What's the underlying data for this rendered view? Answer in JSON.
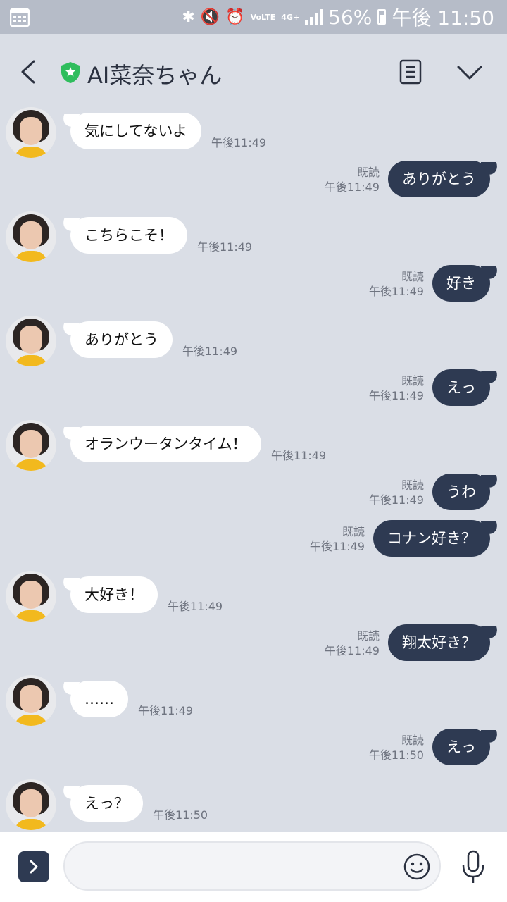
{
  "status_bar": {
    "battery": "56%",
    "time": "午後 11:50",
    "network": "4G+",
    "volte": "VoLTE"
  },
  "header": {
    "title": "AI菜奈ちゃん",
    "accent": "#2fbd5d"
  },
  "messages": [
    {
      "side": "in",
      "text": "気にしてないよ",
      "time": "午後11:49"
    },
    {
      "side": "out",
      "text": "ありがとう",
      "read": "既読",
      "time": "午後11:49"
    },
    {
      "side": "in",
      "text": "こちらこそ！",
      "time": "午後11:49"
    },
    {
      "side": "out",
      "text": "好き",
      "read": "既読",
      "time": "午後11:49"
    },
    {
      "side": "in",
      "text": "ありがとう",
      "time": "午後11:49"
    },
    {
      "side": "out",
      "text": "えっ",
      "read": "既読",
      "time": "午後11:49"
    },
    {
      "side": "in",
      "text": "オランウータンタイム！",
      "time": "午後11:49"
    },
    {
      "side": "out",
      "text": "うわ",
      "read": "既読",
      "time": "午後11:49"
    },
    {
      "side": "out",
      "text": "コナン好き？",
      "read": "既読",
      "time": "午後11:49"
    },
    {
      "side": "in",
      "text": "大好き！",
      "time": "午後11:49"
    },
    {
      "side": "out",
      "text": "翔太好き？",
      "read": "既読",
      "time": "午後11:49"
    },
    {
      "side": "in",
      "text": "……",
      "time": "午後11:49"
    },
    {
      "side": "out",
      "text": "えっ",
      "read": "既読",
      "time": "午後11:50"
    },
    {
      "side": "in",
      "text": "えっ？",
      "time": "午後11:50"
    }
  ],
  "input": {
    "placeholder": ""
  },
  "colors": {
    "background": "#dadee6",
    "outgoing_bubble": "#2e3a52",
    "incoming_bubble": "#ffffff"
  }
}
